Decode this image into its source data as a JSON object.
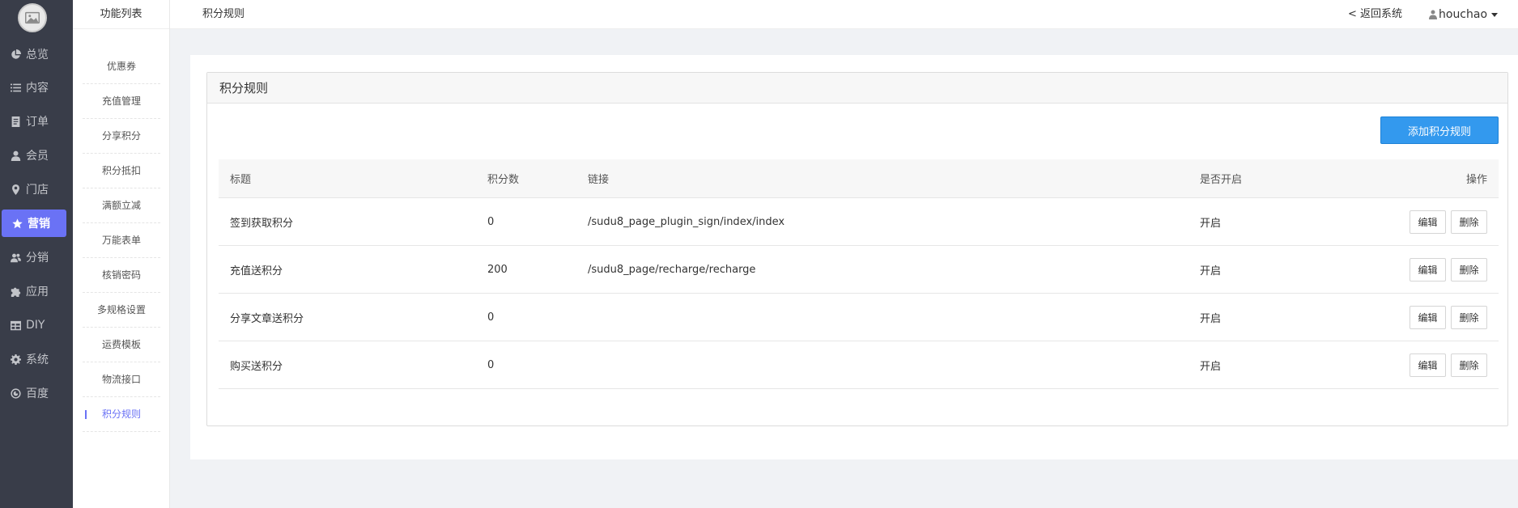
{
  "nav": {
    "items": [
      {
        "label": "总览",
        "icon": "pie-chart-icon"
      },
      {
        "label": "内容",
        "icon": "list-icon"
      },
      {
        "label": "订单",
        "icon": "document-icon"
      },
      {
        "label": "会员",
        "icon": "user-icon"
      },
      {
        "label": "门店",
        "icon": "map-pin-icon"
      },
      {
        "label": "营销",
        "icon": "star-icon"
      },
      {
        "label": "分销",
        "icon": "users-icon"
      },
      {
        "label": "应用",
        "icon": "puzzle-icon"
      },
      {
        "label": "DIY",
        "icon": "table-icon"
      },
      {
        "label": "系统",
        "icon": "gear-icon"
      },
      {
        "label": "百度",
        "icon": "baidu-icon"
      }
    ],
    "active": "营销",
    "active_color": "#6a72f5"
  },
  "subnav": {
    "title": "功能列表",
    "items": [
      "优惠券",
      "充值管理",
      "分享积分",
      "积分抵扣",
      "满额立减",
      "万能表单",
      "核销密码",
      "多规格设置",
      "运费模板",
      "物流接口",
      "积分规则"
    ],
    "active": "积分规则"
  },
  "header": {
    "breadcrumb": "积分规则",
    "back_label": "< 返回系统",
    "username": "houchao"
  },
  "panel": {
    "title": "积分规则",
    "add_button": "添加积分规则",
    "add_button_color": "#3399ee"
  },
  "table": {
    "columns": {
      "title": "标题",
      "points": "积分数",
      "link": "链接",
      "enabled": "是否开启",
      "actions": "操作"
    },
    "rows": [
      {
        "title": "签到获取积分",
        "points": "0",
        "link": "/sudu8_page_plugin_sign/index/index",
        "enabled": "开启"
      },
      {
        "title": "充值送积分",
        "points": "200",
        "link": "/sudu8_page/recharge/recharge",
        "enabled": "开启"
      },
      {
        "title": "分享文章送积分",
        "points": "0",
        "link": "",
        "enabled": "开启"
      },
      {
        "title": "购买送积分",
        "points": "0",
        "link": "",
        "enabled": "开启"
      }
    ],
    "edit_label": "编辑",
    "delete_label": "删除"
  }
}
